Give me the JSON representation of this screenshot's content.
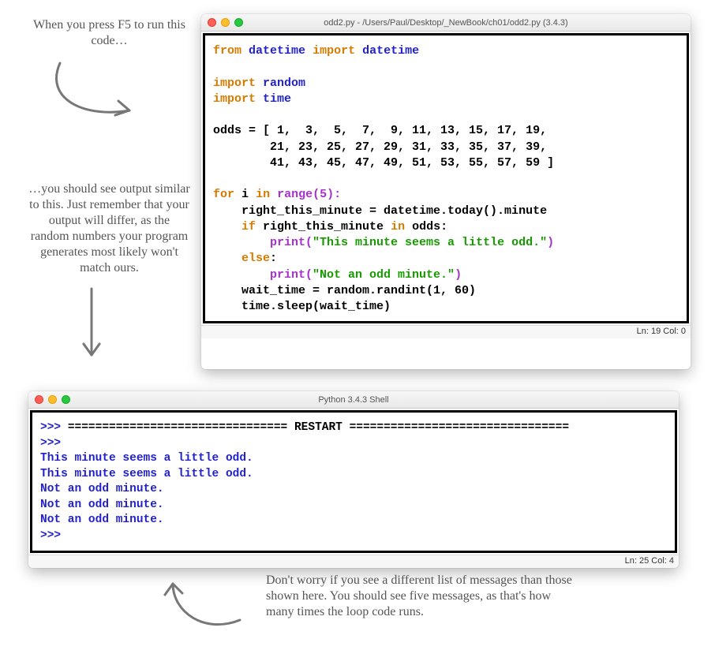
{
  "annotations": {
    "top_note": "When you press F5 to run this code…",
    "mid_note": "…you should see output similar to this. Just remember that your output will differ, as the random numbers your program generates most likely won't match ours.",
    "bottom_note": "Don't worry if you see a different list of messages than those shown here. You should see five messages, as that's how many times the loop code runs."
  },
  "editor": {
    "title": "odd2.py - /Users/Paul/Desktop/_NewBook/ch01/odd2.py (3.4.3)",
    "status": "Ln: 19 Col: 0",
    "tokens": {
      "l1a": "from",
      "l1b": "datetime",
      "l1c": "import",
      "l1d": "datetime",
      "l3a": "import",
      "l3b": "random",
      "l4a": "import",
      "l4b": "time",
      "l6": "odds = [ 1,  3,  5,  7,  9, 11, 13, 15, 17, 19,",
      "l7": "        21, 23, 25, 27, 29, 31, 33, 35, 37, 39,",
      "l8": "        41, 43, 45, 47, 49, 51, 53, 55, 57, 59 ]",
      "l10a": "for",
      "l10b": "i",
      "l10c": "in",
      "l10d": "range(5):",
      "l11": "    right_this_minute = datetime.today().minute",
      "l12a": "    ",
      "l12b": "if",
      "l12c": " right_this_minute ",
      "l12d": "in",
      "l12e": " odds:",
      "l13a": "        print(",
      "l13b": "\"This minute seems a little odd.\"",
      "l13c": ")",
      "l14a": "    ",
      "l14b": "else",
      "l14c": ":",
      "l15a": "        print(",
      "l15b": "\"Not an odd minute.\"",
      "l15c": ")",
      "l16": "    wait_time = random.randint(1, 60)",
      "l17": "    time.sleep(wait_time)"
    }
  },
  "shell": {
    "title": "Python 3.4.3 Shell",
    "status": "Ln: 25 Col: 4",
    "p": ">>> ",
    "restart": "================================ RESTART ================================",
    "out1": "This minute seems a little odd.",
    "out2": "This minute seems a little odd.",
    "out3": "Not an odd minute.",
    "out4": "Not an odd minute.",
    "out5": "Not an odd minute."
  }
}
